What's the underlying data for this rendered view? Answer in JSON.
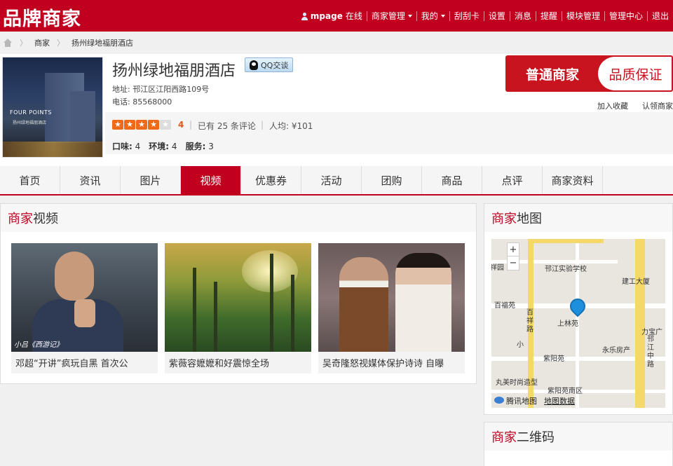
{
  "topbar": {
    "logo": "品牌商家",
    "user": "mpage",
    "online": "在线",
    "nav": [
      "商家管理",
      "我的",
      "刮刮卡",
      "设置",
      "消息",
      "提醒",
      "模块管理",
      "管理中心",
      "退出"
    ]
  },
  "breadcrumb": {
    "items": [
      "商家",
      "扬州绿地福朋酒店"
    ]
  },
  "merchant": {
    "name": "扬州绿地福朋酒店",
    "qq_label": "QQ交谈",
    "address": "地址: 邗江区江阳西路109号",
    "phone": "电话: 85568000",
    "rating": "4",
    "reviews": "已有 25 条评论",
    "avg_price": "人均: ¥101",
    "scores": [
      {
        "label": "口味:",
        "value": "4"
      },
      {
        "label": "环境:",
        "value": "4"
      },
      {
        "label": "服务:",
        "value": "3"
      }
    ],
    "stars_filled": 4,
    "stars_total": 5,
    "badge_left": "普通商家",
    "badge_right": "品质保证",
    "action_favorite": "加入收藏",
    "action_claim": "认领商家",
    "photo_brand": "FOUR POINTS",
    "photo_sub": "扬州绿地福朋酒店"
  },
  "tabs": [
    "首页",
    "资讯",
    "图片",
    "视频",
    "优惠券",
    "活动",
    "团购",
    "商品",
    "点评",
    "商家资料"
  ],
  "active_tab": "视频",
  "video_panel": {
    "title_red": "商家",
    "title_rest": "视频",
    "videos": [
      {
        "caption": "邓超“开讲”疯玩自黑 首次公",
        "subtitle": "小吕《西游记》"
      },
      {
        "caption": "紫薇容嬷嬷和好震惊全场"
      },
      {
        "caption": "吴奇隆怒视媒体保护诗诗 自曝"
      }
    ]
  },
  "map_panel": {
    "title_red": "商家",
    "title_rest": "地图",
    "labels": [
      "祥园",
      "邗江实验学校",
      "建工大厦",
      "百福苑",
      "百祥路",
      "上林苑",
      "力宝广",
      "永乐房产",
      "紫阳苑",
      "丸美时尚造型",
      "紫阳苑南区",
      "邗江中路",
      "小"
    ],
    "zoom_in": "+",
    "zoom_out": "−",
    "provider": "腾讯地图",
    "data_link": "地图数据"
  },
  "qr_panel": {
    "title_red": "商家",
    "title_rest": "二维码"
  }
}
